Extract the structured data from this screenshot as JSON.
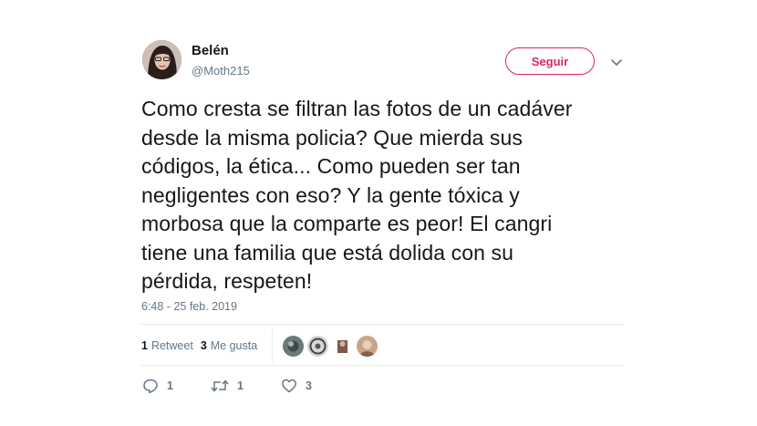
{
  "user": {
    "name": "Belén",
    "handle": "@Moth215"
  },
  "follow_button": {
    "label": "Seguir"
  },
  "tweet": {
    "text": "Como cresta se filtran las fotos de un cadáver\ndesde la misma policia? Que mierda sus\ncódigos, la ética... Como pueden ser tan\nnegligentes con eso? Y la gente tóxica y\nmorbosa que la comparte es peor! El cangri\ntiene una familia que está dolida con su\npérdida, respeten!",
    "timestamp": "6:48 - 25 feb. 2019"
  },
  "stats": {
    "retweets_count": "1",
    "retweets_label": "Retweet",
    "likes_count": "3",
    "likes_label": "Me gusta"
  },
  "actions": {
    "reply_count": "1",
    "retweet_count": "1",
    "like_count": "3"
  },
  "icons": [
    "chevron-down-icon",
    "reply-icon",
    "retweet-icon",
    "heart-icon"
  ],
  "colors": {
    "accent": "#e0245e",
    "muted": "#657786",
    "text": "#14171a",
    "divider": "#e6ecf0"
  }
}
